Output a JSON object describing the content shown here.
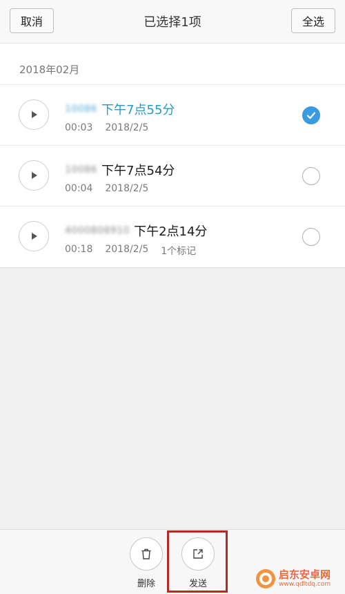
{
  "header": {
    "cancel_label": "取消",
    "title": "已选择1项",
    "select_all_label": "全选"
  },
  "group": {
    "label": "2018年02月"
  },
  "recordings": [
    {
      "number_blurred": "10086",
      "time_label": "下午7点55分",
      "duration": "00:03",
      "date": "2018/2/5",
      "marks": "",
      "selected": true
    },
    {
      "number_blurred": "10086",
      "time_label": "下午7点54分",
      "duration": "00:04",
      "date": "2018/2/5",
      "marks": "",
      "selected": false
    },
    {
      "number_blurred": "4000808910",
      "time_label": "下午2点14分",
      "duration": "00:18",
      "date": "2018/2/5",
      "marks": "1个标记",
      "selected": false
    }
  ],
  "actions": {
    "delete_label": "删除",
    "send_label": "发送"
  },
  "watermark": {
    "name": "启东安卓网",
    "url": "www.qdltdq.com"
  },
  "colors": {
    "accent": "#3a9be0",
    "selected_text": "#2a97c9",
    "highlight": "#b22a22"
  }
}
